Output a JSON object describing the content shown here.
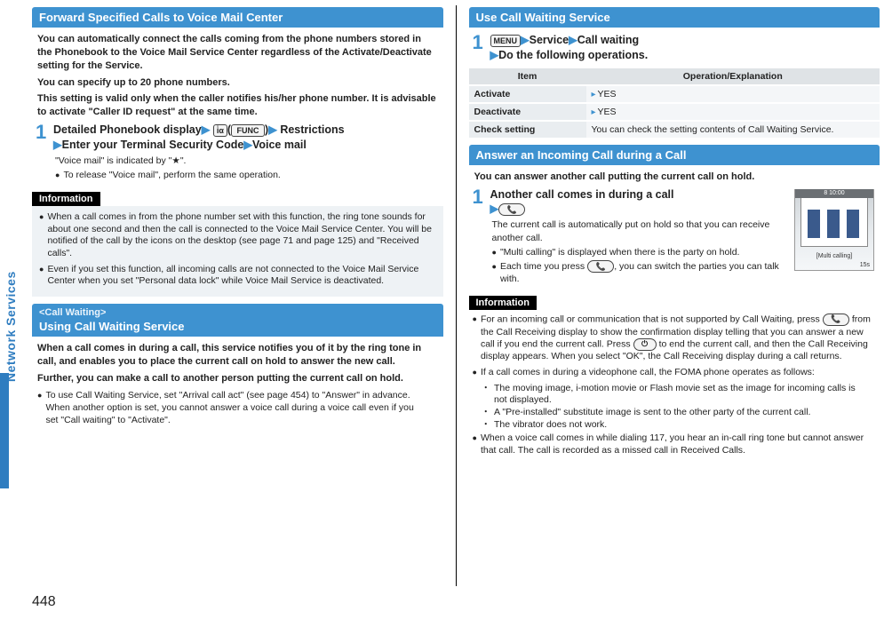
{
  "page_number": "448",
  "side_label": "Network Services",
  "left": {
    "h1": "Forward Specified Calls to Voice Mail Center",
    "intro": [
      "You can automatically connect the calls coming from the phone numbers stored in the Phonebook to the Voice Mail Service Center regardless of the Activate/Deactivate setting for the Service.",
      "You can specify up to 20 phone numbers.",
      "This setting is valid only when the caller notifies his/her phone number. It is advisable to activate \"Caller ID request\" at the same time."
    ],
    "step1": {
      "num": "1",
      "parts": {
        "a": "Detailed Phonebook display",
        "b": "Restrictions",
        "c": "Enter your Terminal Security Code",
        "d": "Voice mail"
      },
      "note1": "\"Voice mail\" is indicated by \"★\".",
      "note2": "To release \"Voice mail\", perform the same operation."
    },
    "info_label": "Information",
    "info": [
      "When a call comes in from the phone number set with this function, the ring tone sounds for about one second and then the call is connected to the Voice Mail Service Center. You will be notified of the call by the icons on the desktop (see page 71 and page 125) and \"Received calls\".",
      "Even if you set this function, all incoming calls are not connected to the Voice Mail Service Center when you set \"Personal data lock\" while Voice Mail Service is deactivated."
    ],
    "h2_sup": "<Call Waiting>",
    "h2": "Using Call Waiting Service",
    "cw_intro": [
      "When a call comes in during a call, this service notifies you of it by the ring tone in call, and enables you to place the current call on hold to answer the new call.",
      "Further, you can make a call to another person putting the current call on hold."
    ],
    "cw_note": "To use Call Waiting Service, set \"Arrival call act\" (see page 454) to \"Answer\" in advance. When another option is set, you cannot answer a voice call during a voice call even if you set \"Call waiting\" to \"Activate\"."
  },
  "right": {
    "h1": "Use Call Waiting Service",
    "step1": {
      "num": "1",
      "parts": {
        "a": "Service",
        "b": "Call waiting",
        "c": "Do the following operations."
      },
      "menu_key": "MENU"
    },
    "table": {
      "head": {
        "c1": "Item",
        "c2": "Operation/Explanation"
      },
      "rows": [
        {
          "c1": "Activate",
          "c2": "YES"
        },
        {
          "c1": "Deactivate",
          "c2": "YES"
        },
        {
          "c1": "Check setting",
          "c2": "You can check the setting contents of Call Waiting Service."
        }
      ]
    },
    "h2": "Answer an Incoming Call during a Call",
    "ans_intro": "You can answer another call putting the current call on hold.",
    "step2": {
      "num": "1",
      "title": "Another call comes in during a call",
      "note1": "The current call is automatically put on hold so that you can receive another call.",
      "note2": "\"Multi calling\" is displayed when there is the party on hold.",
      "note3_a": "Each time you press ",
      "note3_b": ", you can switch the parties you can talk with."
    },
    "screenshot": {
      "bar_top": "8              10:00",
      "t1": "[Multi calling]",
      "t2": "15s"
    },
    "info_label": "Information",
    "info1_a": "For an incoming call or communication that is not supported by Call Waiting, press ",
    "info1_b": " from the Call Receiving display to show the confirmation display telling that you can answer a new call if you end the current call. Press ",
    "info1_c": " to end the current call, and then the Call Receiving display appears. When you select \"OK\", the Call Receiving display during a call returns.",
    "info2": "If a call comes in during a videophone call, the FOMA phone operates as follows:",
    "info2_items": [
      "The moving image, i-motion movie or Flash movie set as the image for incoming calls is not displayed.",
      "A \"Pre-installed\" substitute image is sent to the other party of the current call.",
      "The vibrator does not work."
    ],
    "info3": "When a voice call comes in while dialing 117, you hear an in-call ring tone but cannot answer that call. The call is recorded as a missed call in Received Calls."
  }
}
